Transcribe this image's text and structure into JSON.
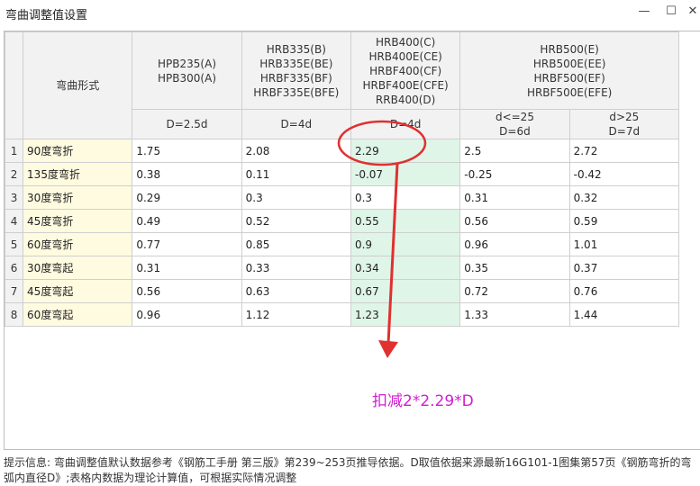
{
  "window": {
    "title": "弯曲调整值设置",
    "min_glyph": "—",
    "max_glyph": "☐",
    "close_glyph": "✕"
  },
  "table": {
    "form_header": "弯曲形式",
    "groups": [
      {
        "lines": [
          "HPB235(A)",
          "HPB300(A)"
        ]
      },
      {
        "lines": [
          "HRB335(B)",
          "HRB335E(BE)",
          "HRBF335(BF)",
          "HRBF335E(BFE)"
        ]
      },
      {
        "lines": [
          "HRB400(C)",
          "HRB400E(CE)",
          "HRBF400(CF)",
          "HRBF400E(CFE)",
          "RRB400(D)"
        ]
      },
      {
        "lines": [
          "HRB500(E)",
          "HRB500E(EE)",
          "HRBF500(EF)",
          "HRBF500E(EFE)"
        ]
      }
    ],
    "d_headers": [
      {
        "lines": [
          "D=2.5d"
        ]
      },
      {
        "lines": [
          "D=4d"
        ]
      },
      {
        "lines": [
          "D=4d"
        ]
      },
      {
        "lines": [
          "d<=25",
          "D=6d"
        ]
      },
      {
        "lines": [
          "d>25",
          "D=7d"
        ]
      }
    ],
    "rows": [
      {
        "num": "1",
        "form": "90度弯折",
        "values": [
          "1.75",
          "2.08",
          "2.29",
          "2.5",
          "2.72"
        ]
      },
      {
        "num": "2",
        "form": "135度弯折",
        "values": [
          "0.38",
          "0.11",
          "-0.07",
          "-0.25",
          "-0.42"
        ]
      },
      {
        "num": "3",
        "form": "30度弯折",
        "values": [
          "0.29",
          "0.3",
          "0.3",
          "0.31",
          "0.32"
        ]
      },
      {
        "num": "4",
        "form": "45度弯折",
        "values": [
          "0.49",
          "0.52",
          "0.55",
          "0.56",
          "0.59"
        ]
      },
      {
        "num": "5",
        "form": "60度弯折",
        "values": [
          "0.77",
          "0.85",
          "0.9",
          "0.96",
          "1.01"
        ]
      },
      {
        "num": "6",
        "form": "30度弯起",
        "values": [
          "0.31",
          "0.33",
          "0.34",
          "0.35",
          "0.37"
        ]
      },
      {
        "num": "7",
        "form": "45度弯起",
        "values": [
          "0.56",
          "0.63",
          "0.67",
          "0.72",
          "0.76"
        ]
      },
      {
        "num": "8",
        "form": "60度弯起",
        "values": [
          "0.96",
          "1.12",
          "1.23",
          "1.33",
          "1.44"
        ]
      }
    ]
  },
  "annotation": {
    "text": "扣减2*2.29*D",
    "color": "#d020d0",
    "circle_color": "#e03030",
    "arrow_color": "#e03030"
  },
  "hint": "提示信息: 弯曲调整值默认数据参考《钢筋工手册 第三版》第239~253页推导依据。D取值依据来源最新16G101-1图集第57页《钢筋弯折的弯弧内直径D》;表格内数据为理论计算值，可根据实际情况调整",
  "colors": {
    "highlight_cell": "#dff5e8",
    "form_cell": "#fffbe0",
    "header": "#f2f2f2"
  }
}
